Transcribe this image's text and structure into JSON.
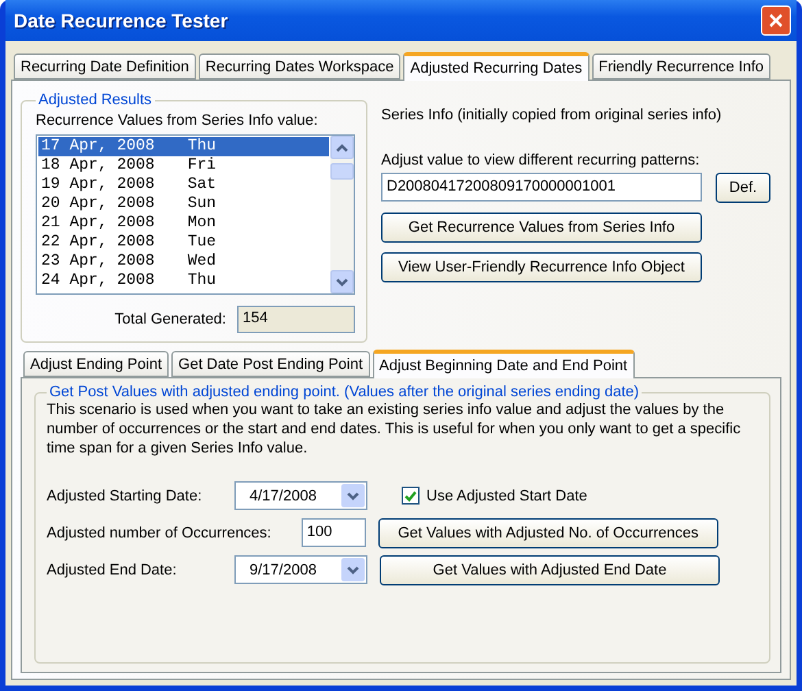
{
  "window": {
    "title": "Date Recurrence Tester"
  },
  "tabs": [
    {
      "label": "Recurring Date Definition",
      "selected": false
    },
    {
      "label": "Recurring Dates Workspace",
      "selected": false
    },
    {
      "label": "Adjusted Recurring Dates",
      "selected": true
    },
    {
      "label": "Friendly Recurrence Info",
      "selected": false
    }
  ],
  "adjusted_results": {
    "title": "Adjusted Results",
    "list_label": "Recurrence Values from Series Info value:",
    "items": [
      {
        "date": "17 Apr, 2008",
        "day": "Thu",
        "selected": true
      },
      {
        "date": "18 Apr, 2008",
        "day": "Fri",
        "selected": false
      },
      {
        "date": "19 Apr, 2008",
        "day": "Sat",
        "selected": false
      },
      {
        "date": "20 Apr, 2008",
        "day": "Sun",
        "selected": false
      },
      {
        "date": "21 Apr, 2008",
        "day": "Mon",
        "selected": false
      },
      {
        "date": "22 Apr, 2008",
        "day": "Tue",
        "selected": false
      },
      {
        "date": "23 Apr, 2008",
        "day": "Wed",
        "selected": false
      },
      {
        "date": "24 Apr, 2008",
        "day": "Thu",
        "selected": false
      }
    ],
    "total_label": "Total Generated:",
    "total_value": "154"
  },
  "series_info": {
    "note": "Series Info (initially copied from original series info)",
    "prompt": "Adjust value to view different recurring patterns:",
    "value": "D20080417200809170000001001",
    "default_button": "Def.",
    "buttons": [
      "Get Recurrence Values from Series Info",
      "View User-Friendly Recurrence Info Object"
    ]
  },
  "sub_tabs": [
    {
      "label": "Adjust Ending Point",
      "selected": false
    },
    {
      "label": "Get Date Post Ending Point",
      "selected": false
    },
    {
      "label": "Adjust Beginning Date and End Point",
      "selected": true
    }
  ],
  "panel": {
    "title": "Get Post Values with adjusted ending point. (Values after the original series ending date)",
    "description": "This scenario is used when you want to take an existing series info value and adjust the values by the number of occurrences or the start and end dates. This is useful for when you only want to get a specific time span for a given Series Info value.",
    "rows": [
      {
        "kind": "date",
        "label": "Adjusted Starting Date:",
        "value": "4/17/2008",
        "checkbox": {
          "label": "Use Adjusted Start Date",
          "checked": true
        }
      },
      {
        "kind": "number",
        "label": "Adjusted number of Occurrences:",
        "value": "100",
        "button": "Get Values with Adjusted No. of Occurrences"
      },
      {
        "kind": "date",
        "label": "Adjusted End Date:",
        "value": "9/17/2008",
        "button": "Get Values with Adjusted End Date"
      }
    ]
  }
}
